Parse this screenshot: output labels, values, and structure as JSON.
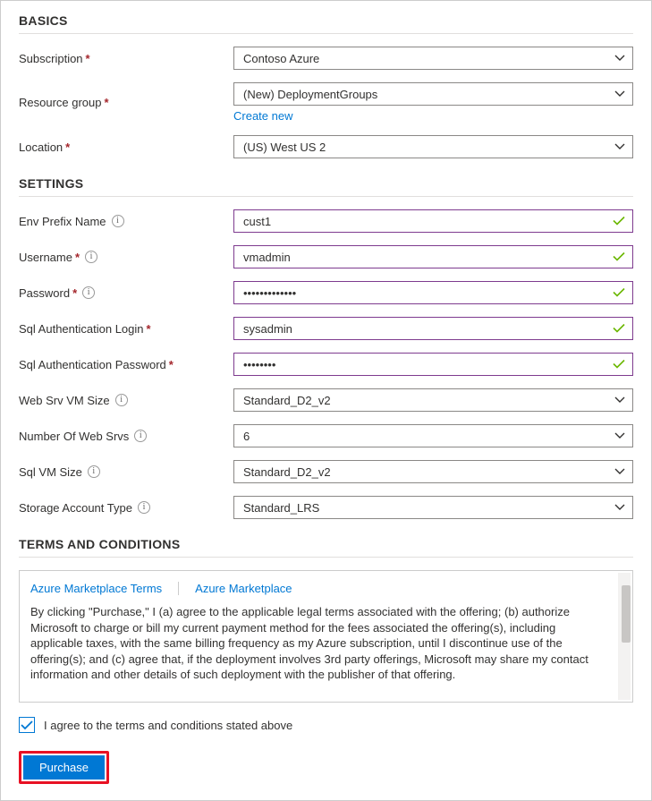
{
  "sections": {
    "basics": "BASICS",
    "settings": "SETTINGS",
    "terms": "TERMS AND CONDITIONS"
  },
  "basics": {
    "subscription": {
      "label": "Subscription",
      "value": "Contoso Azure"
    },
    "resource_group": {
      "label": "Resource group",
      "value": "(New) DeploymentGroups",
      "create_new": "Create new"
    },
    "location": {
      "label": "Location",
      "value": "(US) West US 2"
    }
  },
  "settings": {
    "env_prefix": {
      "label": "Env Prefix Name",
      "value": "cust1"
    },
    "username": {
      "label": "Username",
      "value": "vmadmin"
    },
    "password": {
      "label": "Password",
      "value": "•••••••••••••"
    },
    "sql_login": {
      "label": "Sql Authentication Login",
      "value": "sysadmin"
    },
    "sql_password": {
      "label": "Sql Authentication Password",
      "value": "••••••••"
    },
    "web_vm_size": {
      "label": "Web Srv VM Size",
      "value": "Standard_D2_v2"
    },
    "num_web_srvs": {
      "label": "Number Of Web Srvs",
      "value": "6"
    },
    "sql_vm_size": {
      "label": "Sql VM Size",
      "value": "Standard_D2_v2"
    },
    "storage_type": {
      "label": "Storage Account Type",
      "value": "Standard_LRS"
    }
  },
  "terms": {
    "tab1": "Azure Marketplace Terms",
    "tab2": "Azure Marketplace",
    "body": "By clicking \"Purchase,\" I (a) agree to the applicable legal terms associated with the offering; (b) authorize Microsoft to charge or bill my current payment method for the fees associated the offering(s), including applicable taxes, with the same billing frequency as my Azure subscription, until I discontinue use of the offering(s); and (c) agree that, if the deployment involves 3rd party offerings, Microsoft may share my contact information and other details of such deployment with the publisher of that offering."
  },
  "agree": {
    "label": "I agree to the terms and conditions stated above",
    "checked": true
  },
  "purchase": "Purchase"
}
